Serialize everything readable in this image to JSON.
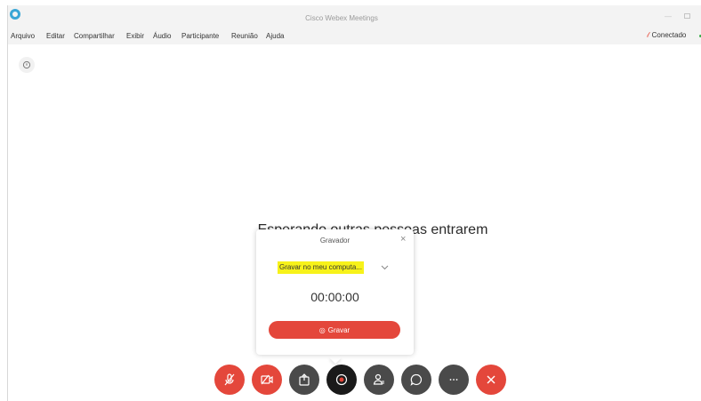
{
  "window": {
    "title": "Cisco Webex Meetings",
    "minimize": "—"
  },
  "menu": {
    "items": [
      "Arquivo",
      "Editar",
      "Compartilhar",
      "Exibir",
      "Áudio",
      "Participante",
      "Reunião",
      "Ajuda"
    ],
    "status": "Conectado"
  },
  "main": {
    "waiting_text": "Esperando outras pessoas entrarem"
  },
  "recorder": {
    "title": "Gravador",
    "close": "×",
    "option": "Gravar no meu computa...",
    "timer": "00:00:00",
    "record_label": "Gravar",
    "record_icon": "◎"
  },
  "controls": [
    "microphone-muted",
    "video-off",
    "share",
    "record",
    "participants",
    "chat",
    "more",
    "end"
  ],
  "colors": {
    "accent_red": "#e4473b",
    "dark_button": "#4a4a4a",
    "highlight": "#f7f21a",
    "connected": "#3dae4a"
  }
}
